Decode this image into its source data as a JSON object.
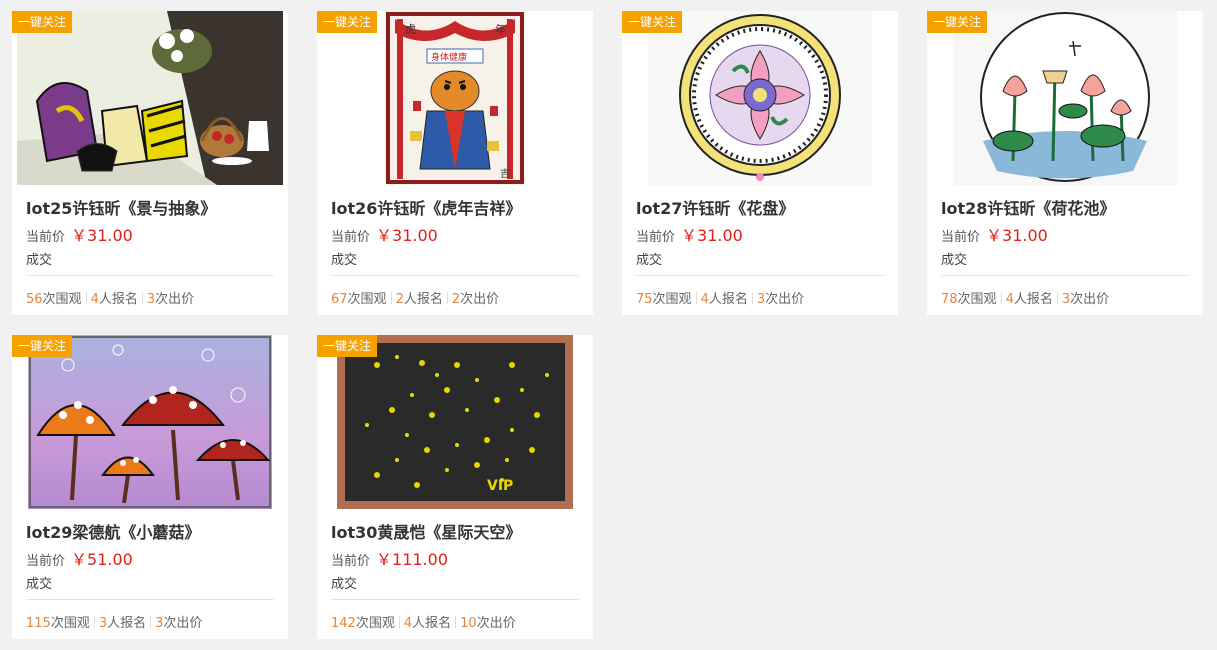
{
  "labels": {
    "follow": "一键关注",
    "price_prefix": "当前价",
    "views_suffix": "次围观",
    "signups_suffix": "人报名",
    "bids_suffix": "次出价"
  },
  "colors": {
    "follow_badge": "#f6a100",
    "price": "#e0201b",
    "stat_number": "#e8833a"
  },
  "lots": [
    {
      "title": "lot25许钰昕《景与抽象》",
      "price": "￥31.00",
      "status": "成交",
      "views": "56",
      "signups": "4",
      "bids": "3"
    },
    {
      "title": "lot26许钰昕《虎年吉祥》",
      "price": "￥31.00",
      "status": "成交",
      "views": "67",
      "signups": "2",
      "bids": "2"
    },
    {
      "title": "lot27许钰昕《花盘》",
      "price": "￥31.00",
      "status": "成交",
      "views": "75",
      "signups": "4",
      "bids": "3"
    },
    {
      "title": "lot28许钰昕《荷花池》",
      "price": "￥31.00",
      "status": "成交",
      "views": "78",
      "signups": "4",
      "bids": "3"
    },
    {
      "title": "lot29梁德航《小蘑菇》",
      "price": "￥51.00",
      "status": "成交",
      "views": "115",
      "signups": "3",
      "bids": "3"
    },
    {
      "title": "lot30黄晟恺《星际天空》",
      "price": "￥111.00",
      "status": "成交",
      "views": "142",
      "signups": "4",
      "bids": "10"
    }
  ],
  "art_text": {
    "tiger_top_left": "虎",
    "tiger_top_right": "年",
    "tiger_scroll": "身体健康",
    "tiger_bottom_right": "吉",
    "sky_sign": "VIP"
  }
}
